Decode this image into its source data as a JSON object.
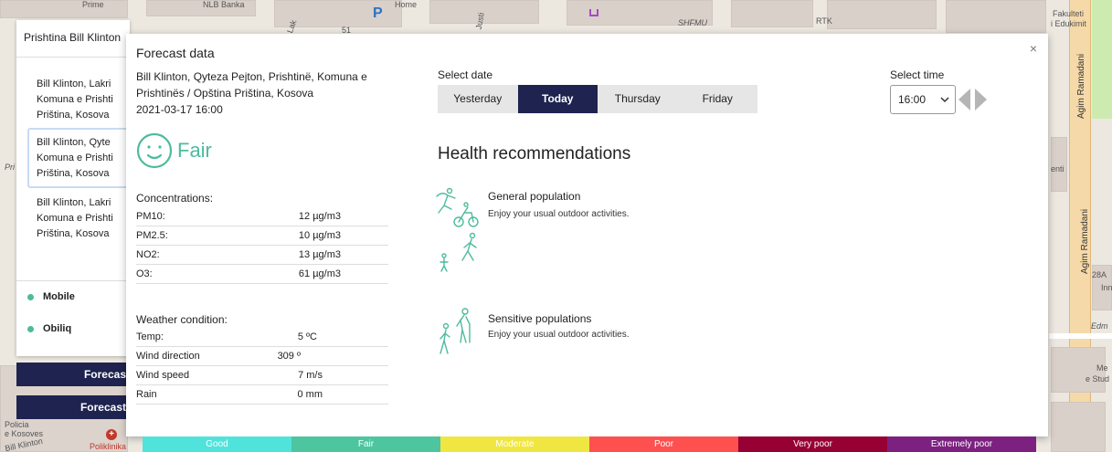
{
  "map": {
    "labels": [
      "Prime",
      "NLB Banka",
      "Home",
      "SHFMU",
      "RTK",
      "Fakulteti",
      "i Edukimit",
      "Agim Ramadani",
      "Agim Ramadani",
      "Pri",
      "enti",
      "28A",
      "Inn",
      "Edm",
      "Me",
      "e Stud",
      "Policia",
      "e Kosoves",
      "Bill Klinton",
      "Poliklinika",
      "Lak",
      "Justi",
      "51"
    ]
  },
  "sidebar": {
    "title": "Prishtina Bill Klinton",
    "items": [
      {
        "lines": [
          "Bill Klinton, Lakri",
          "Komuna e Prishti",
          "Priština, Kosova"
        ]
      },
      {
        "lines": [
          "Bill Klinton, Qyte",
          "Komuna e Prishti",
          "Priština, Kosova"
        ]
      },
      {
        "lines": [
          "Bill Klinton, Lakri",
          "Komuna e Prishti",
          "Priština, Kosova"
        ]
      }
    ],
    "stations": [
      "Mobile",
      "Obiliq"
    ],
    "buttons": [
      "Forecas",
      "Forecast"
    ]
  },
  "modal": {
    "title": "Forecast data",
    "close": "×",
    "address": "Bill Klinton, Qyteza Pejton, Prishtinë, Komuna e Prishtinës / Opština Priština, Kosova",
    "datetime": "2021-03-17 16:00",
    "aqi_level": "Fair",
    "aqi_color": "#4dbb9d",
    "concentrations_title": "Concentrations:",
    "concentrations": [
      {
        "name": "PM10:",
        "value": "12 µg/m3"
      },
      {
        "name": "PM2.5:",
        "value": "10 µg/m3"
      },
      {
        "name": "NO2:",
        "value": "13 µg/m3"
      },
      {
        "name": "O3:",
        "value": "61 µg/m3"
      }
    ],
    "weather_title": "Weather condition:",
    "weather": [
      {
        "name": "Temp:",
        "value": "5 ºC"
      },
      {
        "name": "Wind direction",
        "value": "309 º"
      },
      {
        "name": "Wind speed",
        "value": "7 m/s"
      },
      {
        "name": "Rain",
        "value": "0 mm"
      }
    ],
    "select_date_label": "Select date",
    "date_tabs": [
      "Yesterday",
      "Today",
      "Thursday",
      "Friday"
    ],
    "active_tab": "Today",
    "select_time_label": "Select time",
    "time_value": "16:00",
    "health_title": "Health recommendations",
    "groups": [
      {
        "name": "General population",
        "desc": "Enjoy your usual outdoor activities."
      },
      {
        "name": "Sensitive populations",
        "desc": "Enjoy your usual outdoor activities."
      }
    ]
  },
  "legend": [
    {
      "label": "Good",
      "color": "#50e3dc"
    },
    {
      "label": "Fair",
      "color": "#4dc59f"
    },
    {
      "label": "Moderate",
      "color": "#f0e641"
    },
    {
      "label": "Poor",
      "color": "#ff5050"
    },
    {
      "label": "Very poor",
      "color": "#960032"
    },
    {
      "label": "Extremely poor",
      "color": "#7d2181"
    }
  ]
}
